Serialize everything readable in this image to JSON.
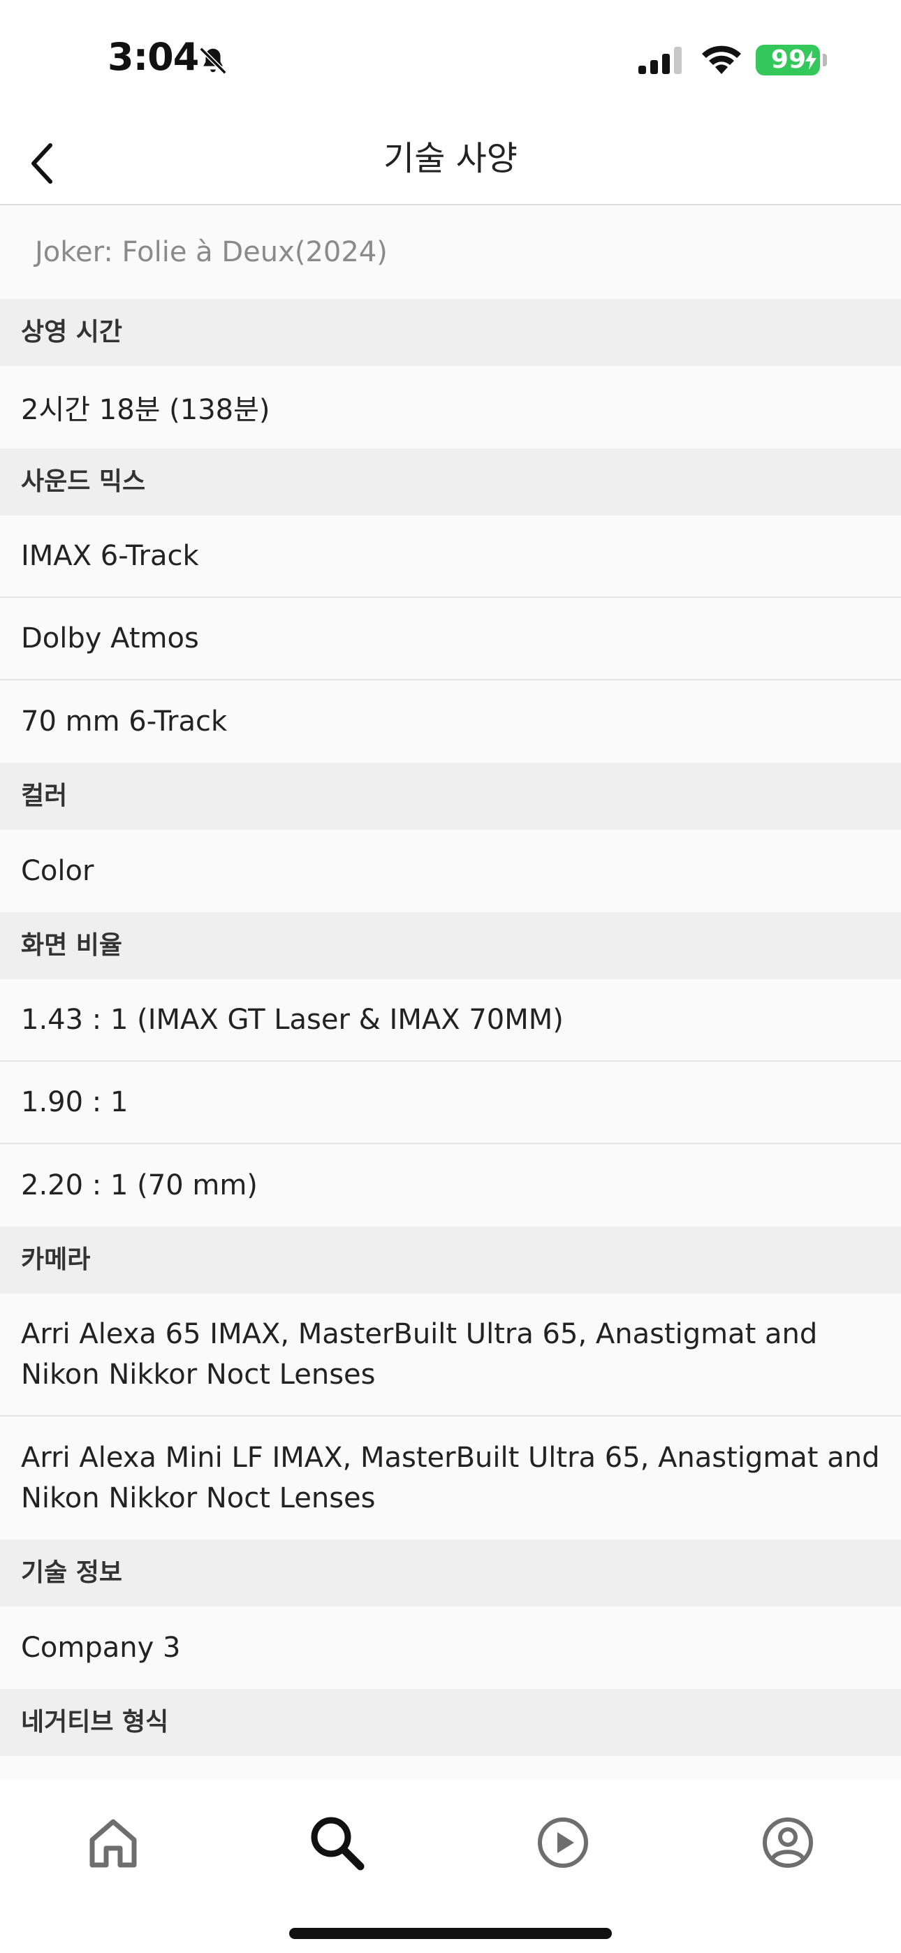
{
  "status_bar": {
    "time": "3:04",
    "battery": "99",
    "battery_color": "#34c759",
    "icons": [
      "bell-slash-icon",
      "cellular-signal-icon",
      "wifi-icon",
      "battery-icon"
    ]
  },
  "nav": {
    "title": "기술 사양",
    "back_icon": "chevron-left-icon"
  },
  "movie_title": "Joker: Folie à Deux(2024)",
  "sections": {
    "runtime": {
      "header": "상영 시간",
      "items": [
        "2시간 18분 (138분)"
      ]
    },
    "sound_mix": {
      "header": "사운드 믹스",
      "items": [
        "IMAX 6-Track",
        "Dolby Atmos",
        "70 mm 6-Track"
      ]
    },
    "color": {
      "header": "컬러",
      "items": [
        "Color"
      ]
    },
    "aspect_ratio": {
      "header": "화면 비율",
      "items": [
        "1.43 : 1 (IMAX GT Laser & IMAX 70MM)",
        "1.90 : 1",
        "2.20 : 1 (70 mm)"
      ]
    },
    "camera": {
      "header": "카메라",
      "items": [
        "Arri Alexa 65 IMAX, MasterBuilt Ultra 65, Anastigmat and Nikon Nikkor Noct Lenses",
        "Arri Alexa Mini LF IMAX, MasterBuilt Ultra 65, Anastigmat and Nikon Nikkor Noct Lenses"
      ]
    },
    "technical_info": {
      "header": "기술 정보",
      "items": [
        "Company 3"
      ]
    },
    "negative_format": {
      "header": "네거티브 형식"
    }
  },
  "tab_bar": {
    "tabs": [
      {
        "name": "home",
        "icon": "home-icon",
        "selected": false
      },
      {
        "name": "search",
        "icon": "search-icon",
        "selected": true
      },
      {
        "name": "play",
        "icon": "play-circle-icon",
        "selected": false
      },
      {
        "name": "profile",
        "icon": "profile-icon",
        "selected": false
      }
    ],
    "selected_color": "#111111",
    "unselected_color": "#6e6e6e"
  }
}
